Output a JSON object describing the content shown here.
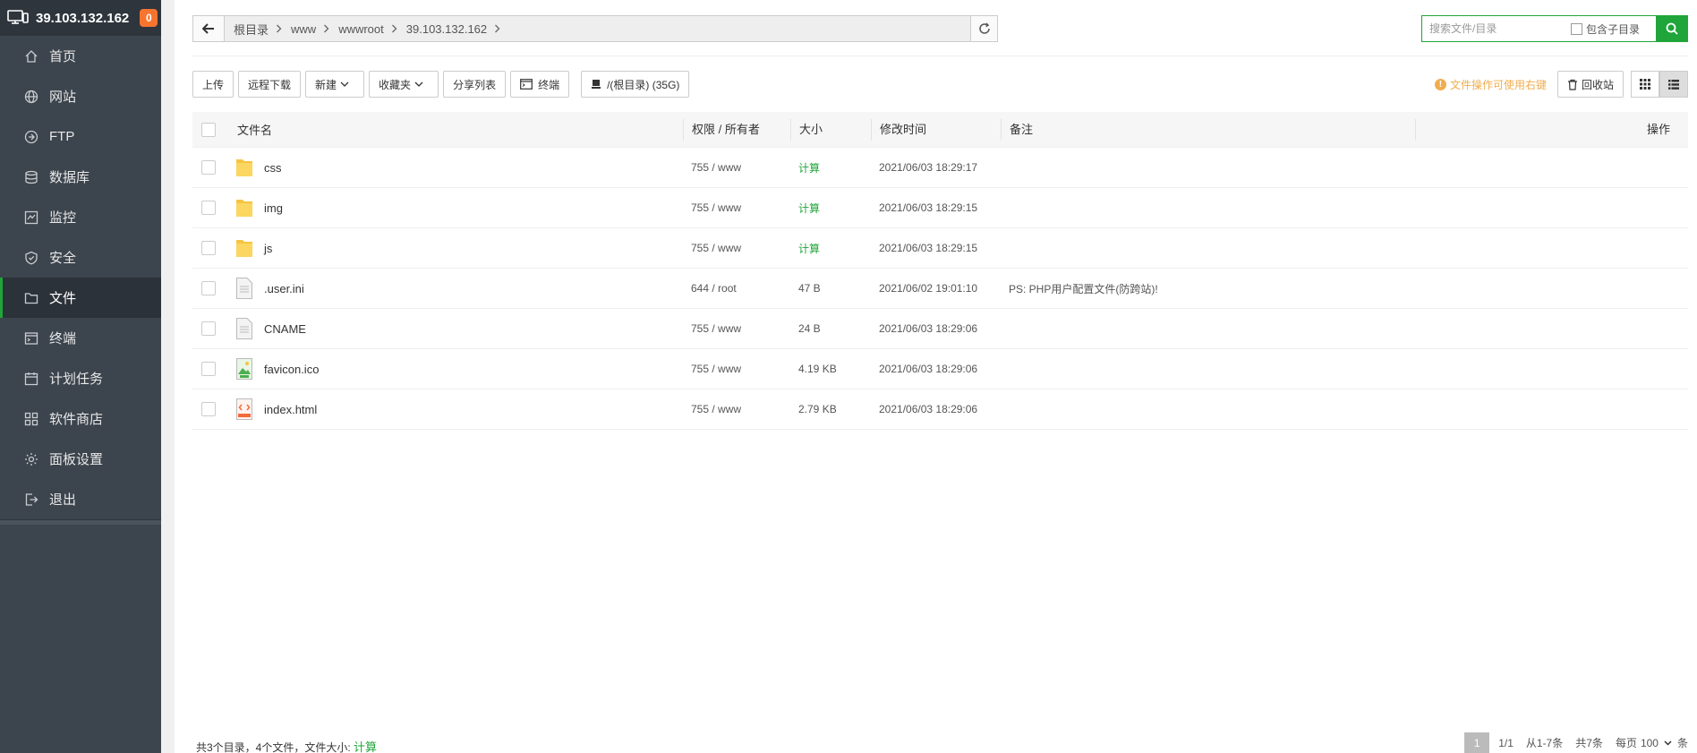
{
  "app": {
    "server_ip": "39.103.132.162",
    "notification_count": "0"
  },
  "sidebar": {
    "items": [
      {
        "label": "首页",
        "icon": "home-icon"
      },
      {
        "label": "网站",
        "icon": "globe-icon"
      },
      {
        "label": "FTP",
        "icon": "ftp-icon"
      },
      {
        "label": "数据库",
        "icon": "database-icon"
      },
      {
        "label": "监控",
        "icon": "monitor-icon"
      },
      {
        "label": "安全",
        "icon": "shield-icon"
      },
      {
        "label": "文件",
        "icon": "folder-icon"
      },
      {
        "label": "终端",
        "icon": "terminal-icon"
      },
      {
        "label": "计划任务",
        "icon": "calendar-icon"
      },
      {
        "label": "软件商店",
        "icon": "grid-icon"
      },
      {
        "label": "面板设置",
        "icon": "gear-icon"
      },
      {
        "label": "退出",
        "icon": "logout-icon"
      }
    ],
    "active_index": 6
  },
  "breadcrumb": [
    "根目录",
    "www",
    "wwwroot",
    "39.103.132.162"
  ],
  "search": {
    "placeholder": "搜索文件/目录",
    "include_subdir_label": "包含子目录"
  },
  "toolbar": {
    "upload": "上传",
    "remote_download": "远程下载",
    "new": "新建",
    "favorites": "收藏夹",
    "share_list": "分享列表",
    "terminal": "终端",
    "disk": "/(根目录) (35G)"
  },
  "tip": "文件操作可使用右键",
  "recycle_bin": "回收站",
  "table": {
    "headers": {
      "name": "文件名",
      "perm": "权限 / 所有者",
      "size": "大小",
      "mtime": "修改时间",
      "note": "备注",
      "op": "操作"
    },
    "rows": [
      {
        "name": "css",
        "type": "folder",
        "perm": "755 / www",
        "size": "计算",
        "mtime": "2021/06/03 18:29:17",
        "note": ""
      },
      {
        "name": "img",
        "type": "folder",
        "perm": "755 / www",
        "size": "计算",
        "mtime": "2021/06/03 18:29:15",
        "note": ""
      },
      {
        "name": "js",
        "type": "folder",
        "perm": "755 / www",
        "size": "计算",
        "mtime": "2021/06/03 18:29:15",
        "note": ""
      },
      {
        "name": ".user.ini",
        "type": "file",
        "perm": "644 / root",
        "size": "47 B",
        "mtime": "2021/06/02 19:01:10",
        "note": "PS: PHP用户配置文件(防跨站)!"
      },
      {
        "name": "CNAME",
        "type": "file",
        "perm": "755 / www",
        "size": "24 B",
        "mtime": "2021/06/03 18:29:06",
        "note": ""
      },
      {
        "name": "favicon.ico",
        "type": "image",
        "perm": "755 / www",
        "size": "4.19 KB",
        "mtime": "2021/06/03 18:29:06",
        "note": ""
      },
      {
        "name": "index.html",
        "type": "html",
        "perm": "755 / www",
        "size": "2.79 KB",
        "mtime": "2021/06/03 18:29:06",
        "note": ""
      }
    ]
  },
  "footer": {
    "summary": "共3个目录，4个文件，文件大小:",
    "calc": "计算",
    "page": "1",
    "page_of": "1/1",
    "range": "从1-7条",
    "total": "共7条",
    "per_page_label": "每页",
    "per_page_value": "100",
    "unit": "条"
  },
  "colors": {
    "accent": "#20a53a",
    "sidebar_bg": "#3c444d",
    "badge": "#f7742f",
    "warn": "#f0ad4e"
  }
}
